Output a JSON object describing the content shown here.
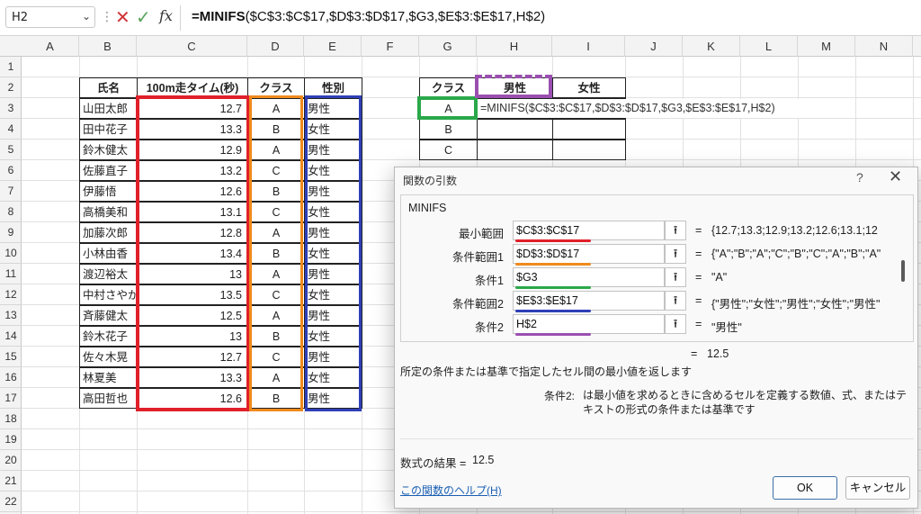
{
  "formula_bar": {
    "name_box": "H2",
    "formula_prefix": "=MINIFS",
    "formula_rest": "($C$3:$C$17,$D$3:$D$17,$G3,$E$3:$E$17,H$2)"
  },
  "columns": [
    "A",
    "B",
    "C",
    "D",
    "E",
    "F",
    "G",
    "H",
    "I",
    "J",
    "K",
    "L",
    "M",
    "N"
  ],
  "rows": [
    "1",
    "2",
    "3",
    "4",
    "5",
    "6",
    "7",
    "8",
    "9",
    "10",
    "11",
    "12",
    "13",
    "14",
    "15",
    "16",
    "17",
    "18",
    "19",
    "20",
    "21",
    "22"
  ],
  "table1": {
    "headers": [
      "氏名",
      "100m走タイム(秒)",
      "クラス",
      "性別"
    ],
    "rows": [
      [
        "山田太郎",
        "12.7",
        "A",
        "男性"
      ],
      [
        "田中花子",
        "13.3",
        "B",
        "女性"
      ],
      [
        "鈴木健太",
        "12.9",
        "A",
        "男性"
      ],
      [
        "佐藤直子",
        "13.2",
        "C",
        "女性"
      ],
      [
        "伊藤悟",
        "12.6",
        "B",
        "男性"
      ],
      [
        "高橋美和",
        "13.1",
        "C",
        "女性"
      ],
      [
        "加藤次郎",
        "12.8",
        "A",
        "男性"
      ],
      [
        "小林由香",
        "13.4",
        "B",
        "女性"
      ],
      [
        "渡辺裕太",
        "13",
        "A",
        "男性"
      ],
      [
        "中村さやか",
        "13.5",
        "C",
        "女性"
      ],
      [
        "斉藤健太",
        "12.5",
        "A",
        "男性"
      ],
      [
        "鈴木花子",
        "13",
        "B",
        "女性"
      ],
      [
        "佐々木晃",
        "12.7",
        "C",
        "男性"
      ],
      [
        "林夏美",
        "13.3",
        "A",
        "女性"
      ],
      [
        "高田哲也",
        "12.6",
        "B",
        "男性"
      ]
    ]
  },
  "table2": {
    "headers": [
      "クラス",
      "男性",
      "女性"
    ],
    "classes": [
      "A",
      "B",
      "C"
    ],
    "editing_formula": "=MINIFS($C$3:$C$17,$D$3:$D$17,$G3,$E$3:$E$17,H$2)"
  },
  "dialog": {
    "title": "関数の引数",
    "help_icon": "?",
    "close_icon": "✕",
    "function_name": "MINIFS",
    "args": [
      {
        "label": "最小範囲",
        "value": "$C$3:$C$17",
        "result": "{12.7;13.3;12.9;13.2;12.6;13.1;12",
        "color": "#e0202a"
      },
      {
        "label": "条件範囲1",
        "value": "$D$3:$D$17",
        "result": "{\"A\";\"B\";\"A\";\"C\";\"B\";\"C\";\"A\";\"B\";\"A\"",
        "color": "#f08a1c"
      },
      {
        "label": "条件1",
        "value": "$G3",
        "result": "\"A\"",
        "color": "#2aa84a"
      },
      {
        "label": "条件範囲2",
        "value": "$E$3:$E$17",
        "result": "{\"男性\";\"女性\";\"男性\";\"女性\";\"男性\"",
        "color": "#2f3fb7"
      },
      {
        "label": "条件2",
        "value": "H$2",
        "result": "\"男性\"",
        "color": "#9a4fb0"
      }
    ],
    "equals": "=",
    "function_result": "12.5",
    "description": "所定の条件または基準で指定したセル間の最小値を返します",
    "arg_desc_label": "条件2:",
    "arg_desc": "は最小値を求めるときに含めるセルを定義する数値、式、またはテキストの形式の条件または基準です",
    "formula_result_label": "数式の結果 =",
    "formula_result": "12.5",
    "help_link": "この関数のヘルプ(H)",
    "ok": "OK",
    "cancel": "キャンセル"
  },
  "colors": {
    "red": "#e0202a",
    "orange": "#f08a1c",
    "blue": "#2f3fb7",
    "green": "#2aa84a",
    "purple": "#9a4fb0"
  }
}
